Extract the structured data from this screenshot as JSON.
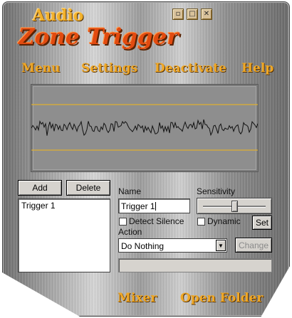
{
  "app": {
    "title_line1": "Audio",
    "title_line2": "Zone Trigger"
  },
  "window_controls": [
    {
      "name": "minimize-icon",
      "glyph": "▫"
    },
    {
      "name": "maximize-icon",
      "glyph": "□"
    },
    {
      "name": "close-icon",
      "glyph": "✕"
    }
  ],
  "menu": {
    "menu": "Menu",
    "settings": "Settings",
    "deactivate": "Deactivate",
    "help": "Help"
  },
  "triggers": {
    "add_label": "Add",
    "delete_label": "Delete",
    "items": [
      "Trigger 1"
    ]
  },
  "details": {
    "name_label": "Name",
    "name_value": "Trigger 1",
    "sensitivity_label": "Sensitivity",
    "sensitivity_value": 0.5,
    "detect_silence_label": "Detect Silence",
    "detect_silence_checked": false,
    "dynamic_label": "Dynamic",
    "dynamic_checked": false,
    "set_label": "Set",
    "action_label": "Action",
    "action_value": "Do Nothing",
    "change_label": "Change",
    "status_text": ""
  },
  "bottom": {
    "mixer": "Mixer",
    "open_folder": "Open Folder"
  },
  "colors": {
    "gold": "#f0a826",
    "orange_red": "#e24b10",
    "threshold_line": "#e0b030",
    "waveform": "#111111"
  }
}
